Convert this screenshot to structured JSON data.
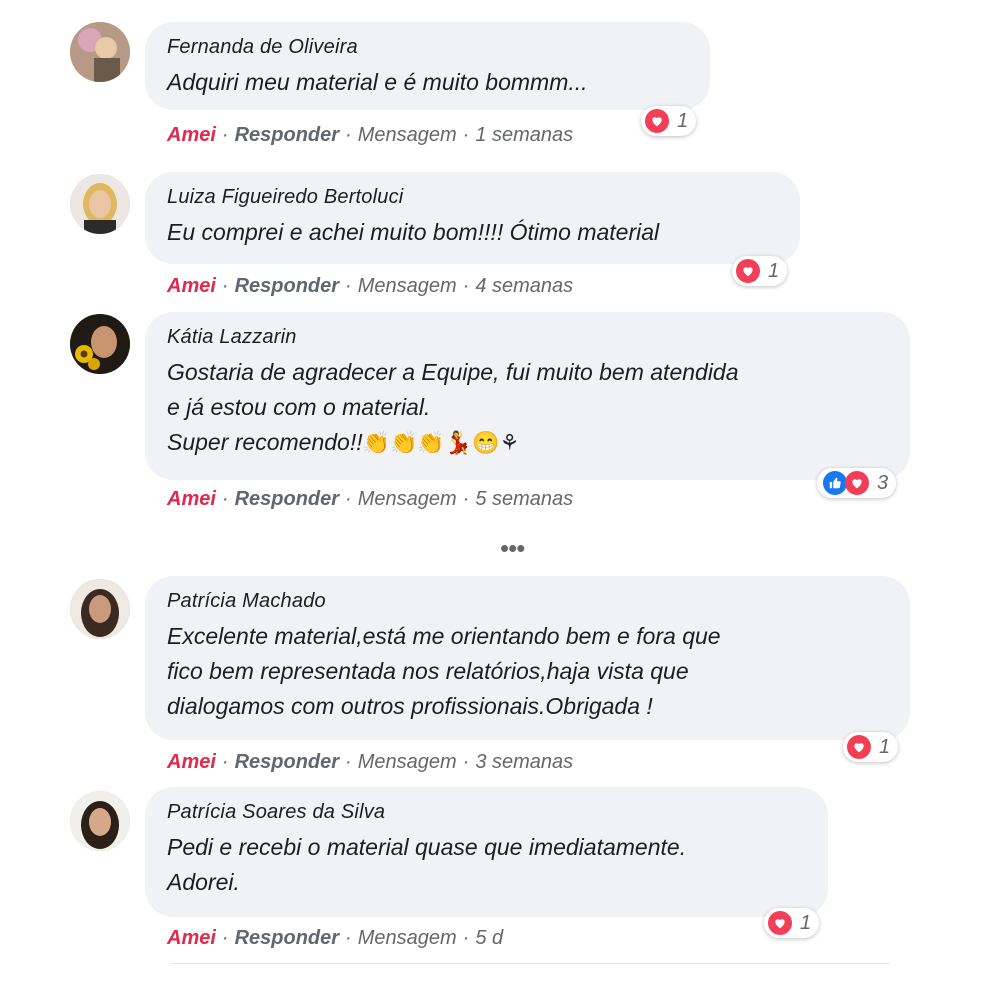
{
  "comments": [
    {
      "author": "Fernanda de Oliveira",
      "text": "Adquiri meu material e é muito bommm...",
      "like_label": "Amei",
      "reply_label": "Responder",
      "message_label": "Mensagem",
      "time": "1 semanas",
      "reaction_count": "1"
    },
    {
      "author": "Luiza Figueiredo Bertoluci",
      "text": "Eu comprei e achei muito bom!!!! Ótimo material",
      "like_label": "Amei",
      "reply_label": "Responder",
      "message_label": "Mensagem",
      "time": "4 semanas",
      "reaction_count": "1"
    },
    {
      "author": "Kátia Lazzarin",
      "text": "Gostaria de agradecer a Equipe, fui muito bem atendida\ne já estou com o material.\nSuper recomendo!!",
      "emojis": "👏👏👏💃😁⚘",
      "like_label": "Amei",
      "reply_label": "Responder",
      "message_label": "Mensagem",
      "time": "5 semanas",
      "reaction_count": "3"
    },
    {
      "author": "Patrícia Machado",
      "text": "Excelente material,está me orientando bem e fora que\nfico bem representada nos relatórios,haja vista que\ndialogamos com outros profissionais.Obrigada !",
      "like_label": "Amei",
      "reply_label": "Responder",
      "message_label": "Mensagem",
      "time": "3 semanas",
      "reaction_count": "1"
    },
    {
      "author": "Patrícia Soares da Silva",
      "text": "Pedi e recebi o material quase que imediatamente.\nAdorei.",
      "like_label": "Amei",
      "reply_label": "Responder",
      "message_label": "Mensagem",
      "time": "5 d",
      "reaction_count": "1"
    }
  ],
  "more_indicator": "•••",
  "colors": {
    "like_red": "#e0294b",
    "bubble": "#f0f2f5",
    "heart": "#f33e58",
    "like_blue": "#1877f2"
  }
}
